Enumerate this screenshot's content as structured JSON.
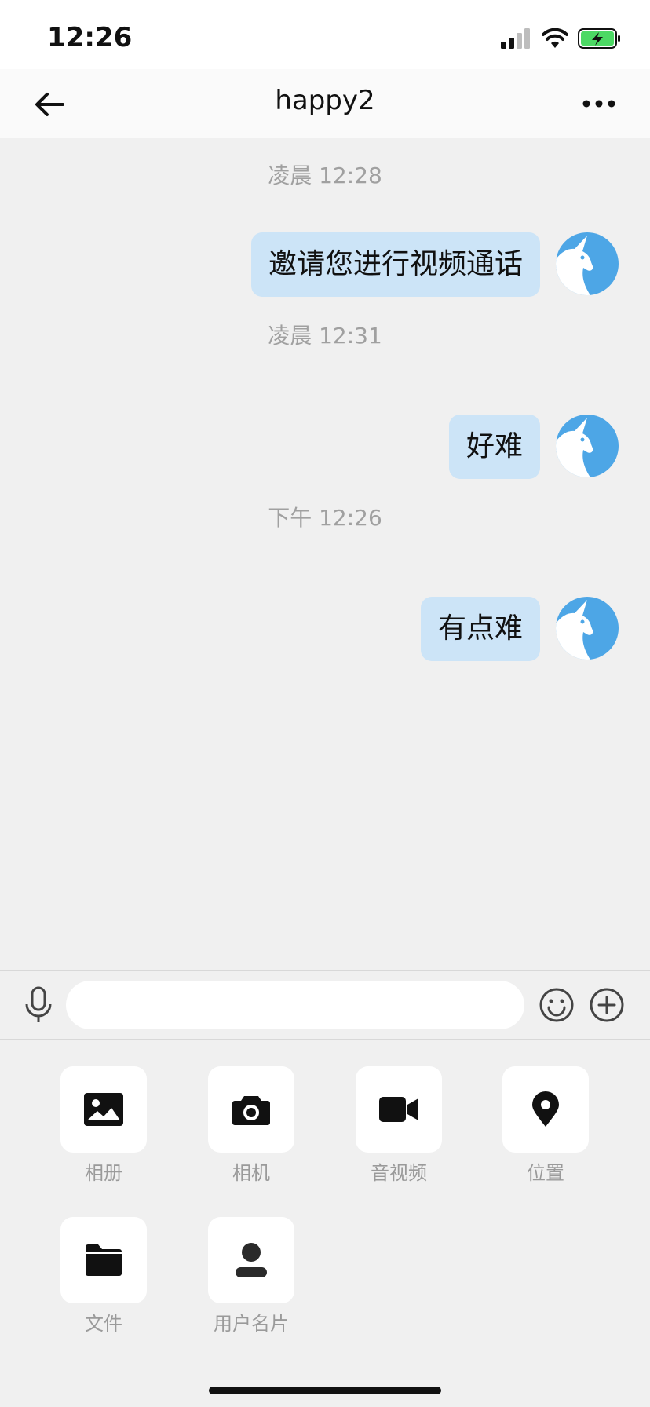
{
  "status_bar": {
    "time": "12:26"
  },
  "header": {
    "title": "happy2"
  },
  "messages": [
    {
      "time": "凌晨 12:28",
      "text": "邀请您进行视频通话"
    },
    {
      "time": "凌晨 12:31",
      "text": "好难"
    },
    {
      "time": "下午 12:26",
      "text": "有点难"
    }
  ],
  "input": {
    "value": "",
    "placeholder": ""
  },
  "tools": [
    {
      "label": "相册",
      "icon": "image-icon"
    },
    {
      "label": "相机",
      "icon": "camera-icon"
    },
    {
      "label": "音视频",
      "icon": "video-icon"
    },
    {
      "label": "位置",
      "icon": "location-pin-icon"
    },
    {
      "label": "文件",
      "icon": "folder-icon"
    },
    {
      "label": "用户名片",
      "icon": "user-card-icon"
    }
  ],
  "colors": {
    "bubble": "#cce4f7",
    "avatar": "#4da6e6",
    "background": "#f0f0f0",
    "battery": "#4cd964"
  }
}
